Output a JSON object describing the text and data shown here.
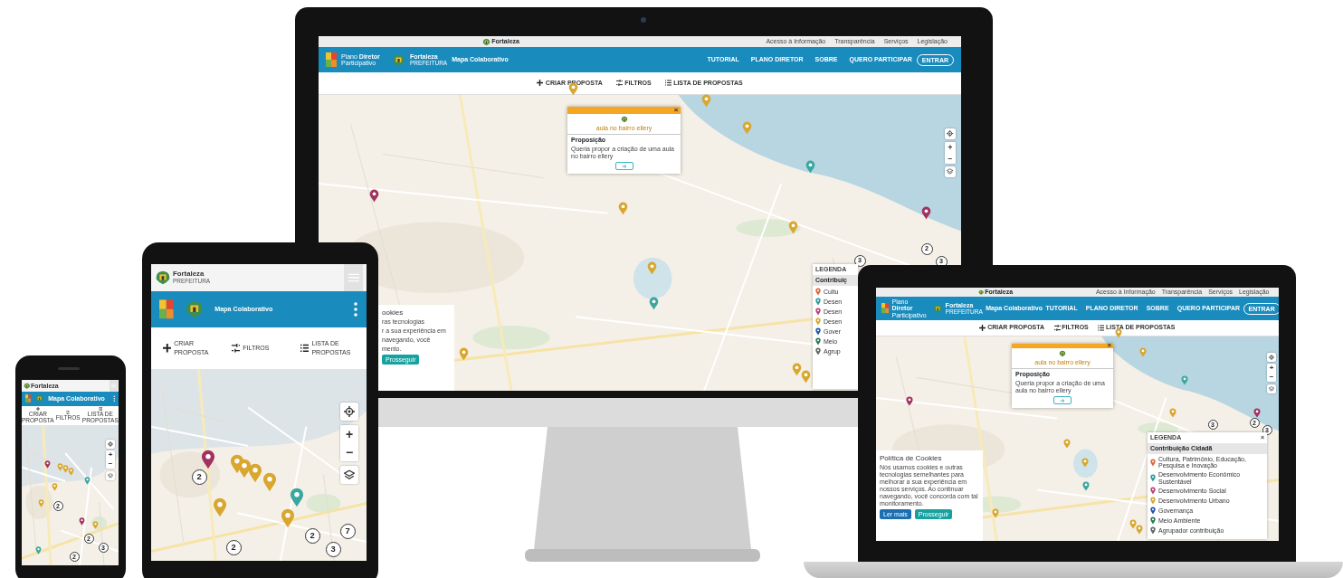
{
  "screens": [
    {
      "kind": "phone",
      "topbar": {
        "logo": "Fortaleza"
      },
      "header": {
        "title": "Mapa Colaborativo"
      },
      "toolbar": [
        "CRIAR PROPOSTA",
        "FILTROS",
        "LISTA DE PROPOSTAS"
      ],
      "controls": [
        "+",
        "−"
      ],
      "markers": [
        {
          "color": "#a3315f"
        },
        {
          "color": "#d9a62e"
        },
        {
          "color": "#d9a62e"
        },
        {
          "color": "#d9a62e"
        },
        {
          "color": "#3aa6a0"
        },
        {
          "color": "#d9a62e"
        },
        {
          "color": "#d9a62e"
        },
        {
          "color": "#d9a62e"
        },
        {
          "color": "#a3315f"
        },
        {
          "color": "#3aa6a0"
        }
      ],
      "clusters": [
        "2",
        "2",
        "3",
        "2"
      ]
    },
    {
      "kind": "tablet",
      "topbar": {
        "logo": "Fortaleza",
        "logo_sub": "PREFEITURA"
      },
      "header": {
        "title": "Mapa Colaborativo"
      },
      "toolbar": [
        "CRIAR PROPOSTA",
        "FILTROS",
        "LISTA DE PROPOSTAS"
      ],
      "controls": [
        "+",
        "−"
      ],
      "markers": [
        {
          "color": "#a3315f"
        },
        {
          "color": "#d9a62e"
        },
        {
          "color": "#d9a62e"
        },
        {
          "color": "#d9a62e"
        },
        {
          "color": "#d9a62e"
        },
        {
          "color": "#3aa6a0"
        },
        {
          "color": "#d9a62e"
        },
        {
          "color": "#d9a62e"
        }
      ],
      "clusters": [
        "2",
        "2",
        "2",
        "3",
        "7"
      ]
    },
    {
      "kind": "monitor",
      "topbar": {
        "logo": "Fortaleza",
        "links": [
          "Acesso à Informação",
          "Transparência",
          "Serviços",
          "Legislação"
        ]
      },
      "header": {
        "program": "Plano **Diretor** Participativo",
        "city": "Fortaleza",
        "city_sub": "PREFEITURA",
        "title": "Mapa Colaborativo",
        "nav": [
          "TUTORIAL",
          "PLANO DIRETOR",
          "SOBRE",
          "QUERO PARTICIPAR"
        ],
        "login": "ENTRAR"
      },
      "toolbar": [
        "CRIAR PROPOSTA",
        "FILTROS",
        "LISTA DE PROPOSTAS"
      ],
      "popup": {
        "title": "aula no bairro ellery",
        "close": "×",
        "heading": "Proposição",
        "body": "Queria propor a criação de uma aula no bairro ellery"
      },
      "cookie": {
        "title": "ookies",
        "lines": [
          "ras tecnologias",
          "r a sua experiência em",
          "navegando, você",
          "mento."
        ],
        "buttons": [
          {
            "label": "Prosseguir",
            "kind": "accept"
          }
        ]
      },
      "legend": {
        "title": "LEGENDA",
        "group": "Contribuiç",
        "items": [
          {
            "label": "Cultu",
            "color": "#e0663a"
          },
          {
            "label": "Desen",
            "color": "#2a9d9a"
          },
          {
            "label": "Desen",
            "color": "#c0407c"
          },
          {
            "label": "Desen",
            "color": "#d9a62e"
          },
          {
            "label": "Gover",
            "color": "#2455b0"
          },
          {
            "label": "Meio",
            "color": "#2a7a55"
          },
          {
            "label": "Agrup",
            "color": "#666666"
          }
        ]
      },
      "controls": [
        "+",
        "−"
      ],
      "markers": [
        {
          "color": "#d9a62e"
        },
        {
          "color": "#d9a62e"
        },
        {
          "color": "#d9a62e"
        },
        {
          "color": "#3aa6a0"
        },
        {
          "color": "#a3315f"
        },
        {
          "color": "#d9a62e"
        },
        {
          "color": "#d9a62e"
        },
        {
          "color": "#a3315f"
        },
        {
          "color": "#d9a62e"
        },
        {
          "color": "#3aa6a0"
        },
        {
          "color": "#d9a62e"
        },
        {
          "color": "#d9a62e"
        },
        {
          "color": "#d9a62e"
        }
      ],
      "clusters": [
        "2",
        "3",
        "3"
      ]
    },
    {
      "kind": "laptop",
      "topbar": {
        "logo": "Fortaleza",
        "links": [
          "Acesso à Informação",
          "Transparência",
          "Serviços",
          "Legislação"
        ]
      },
      "header": {
        "program": "Plano **Diretor** Participativo",
        "city": "Fortaleza",
        "city_sub": "PREFEITURA",
        "title": "Mapa Colaborativo",
        "nav": [
          "TUTORIAL",
          "PLANO DIRETOR",
          "SOBRE",
          "QUERO PARTICIPAR"
        ],
        "login": "ENTRAR"
      },
      "toolbar": [
        "CRIAR PROPOSTA",
        "FILTROS",
        "LISTA DE PROPOSTAS"
      ],
      "popup": {
        "title": "aula no bairro ellery",
        "close": "×",
        "heading": "Proposição",
        "body": "Queria propor a criação de uma aula no bairro ellery"
      },
      "cookie": {
        "title": "Política de Cookies",
        "body": "Nós usamos cookies e outras tecnologias semelhantes para melhorar a sua experiência em nossos serviços. Ao continuar navegando, você concorda com tal monitoramento.",
        "buttons": [
          {
            "label": "Ler mais",
            "kind": "primary"
          },
          {
            "label": "Prosseguir",
            "kind": "accept"
          }
        ]
      },
      "legend": {
        "title": "LEGENDA",
        "close": "×",
        "group": "Contribuição Cidadã",
        "items": [
          {
            "label": "Cultura, Patrimônio, Educação, Pesquisa e Inovação",
            "color": "#e0663a"
          },
          {
            "label": "Desenvolvimento Econômico Sustentável",
            "color": "#2a9d9a"
          },
          {
            "label": "Desenvolvimento Social",
            "color": "#c0407c"
          },
          {
            "label": "Desenvolvimento Urbano",
            "color": "#d9a62e"
          },
          {
            "label": "Governança",
            "color": "#2455b0"
          },
          {
            "label": "Meio Ambiente",
            "color": "#2a7a55"
          },
          {
            "label": "Agrupador contribuição",
            "color": "#666666"
          }
        ]
      },
      "controls": [
        "+",
        "−"
      ],
      "markers": [
        {
          "color": "#d9a62e"
        },
        {
          "color": "#d9a62e"
        },
        {
          "color": "#3aa6a0"
        },
        {
          "color": "#a3315f"
        },
        {
          "color": "#d9a62e"
        },
        {
          "color": "#d9a62e"
        },
        {
          "color": "#a3315f"
        },
        {
          "color": "#d9a62e"
        },
        {
          "color": "#3aa6a0"
        },
        {
          "color": "#d9a62e"
        },
        {
          "color": "#d9a62e"
        },
        {
          "color": "#d9a62e"
        }
      ],
      "clusters": [
        "2",
        "3",
        "3"
      ]
    }
  ]
}
